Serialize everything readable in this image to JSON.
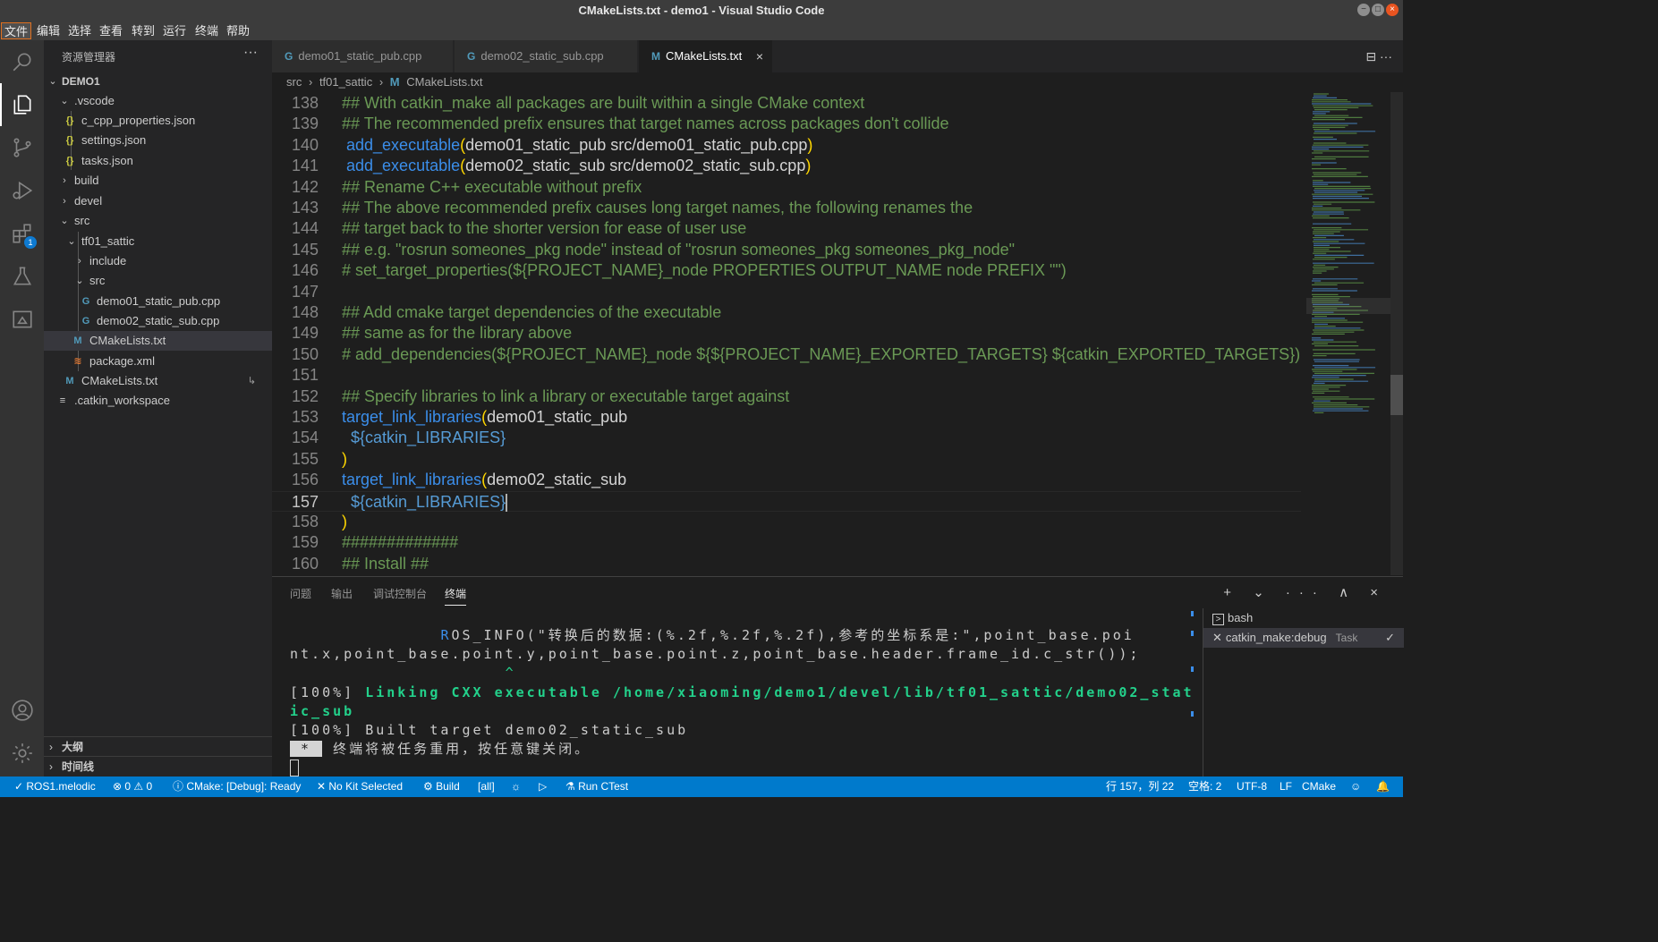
{
  "window": {
    "title": "CMakeLists.txt - demo1 - Visual Studio Code",
    "controls": [
      "−",
      "□",
      "×"
    ]
  },
  "menu": [
    "文件",
    "编辑",
    "选择",
    "查看",
    "转到",
    "运行",
    "终端",
    "帮助"
  ],
  "activity": {
    "items": [
      "search-icon",
      "explorer-icon",
      "source-control-icon",
      "run-debug-icon",
      "extensions-icon",
      "testing-icon",
      "remote-explorer-icon",
      "account-icon",
      "settings-gear-icon"
    ],
    "extensions_badge": "1"
  },
  "sidebar": {
    "title": "资源管理器",
    "more": "···",
    "root": "DEMO1",
    "tree": [
      {
        "label": ".vscode",
        "icon": "",
        "chev": "⌄"
      },
      {
        "label": "c_cpp_properties.json",
        "icon": "{}"
      },
      {
        "label": "settings.json",
        "icon": "{}"
      },
      {
        "label": "tasks.json",
        "icon": "{}"
      },
      {
        "label": "build",
        "chev": "›"
      },
      {
        "label": "devel",
        "chev": "›"
      },
      {
        "label": "src",
        "chev": "⌄"
      },
      {
        "label": "tf01_sattic",
        "chev": "⌄"
      },
      {
        "label": "include",
        "chev": "›"
      },
      {
        "label": "src",
        "chev": "⌄"
      },
      {
        "label": "demo01_static_pub.cpp",
        "icon": "G"
      },
      {
        "label": "demo02_static_sub.cpp",
        "icon": "G"
      },
      {
        "label": "CMakeLists.txt",
        "icon": "M"
      },
      {
        "label": "package.xml",
        "icon": "≋"
      },
      {
        "label": "CMakeLists.txt",
        "icon": "M",
        "extra": "↳"
      },
      {
        "label": ".catkin_workspace",
        "icon": "≡"
      }
    ],
    "outline": "大纲",
    "timeline": "时间线"
  },
  "tabs": [
    {
      "icon": "G",
      "label": "demo01_static_pub.cpp"
    },
    {
      "icon": "G",
      "label": "demo02_static_sub.cpp"
    },
    {
      "icon": "M",
      "label": "CMakeLists.txt",
      "close": "×"
    }
  ],
  "tab_actions": "⊟  ···",
  "breadcrumb": [
    "src",
    "›",
    "tf01_sattic",
    "›",
    "M",
    "CMakeLists.txt"
  ],
  "editor": {
    "lines": [
      {
        "n": "138",
        "t": "## With catkin_make all packages are built within a single CMake context"
      },
      {
        "n": "139",
        "t": "## The recommended prefix ensures that target names across packages don't collide"
      },
      {
        "n": "140",
        "fn": " add_executable",
        "p1": "(",
        "args": "demo01_static_pub src/demo01_static_pub.cpp",
        "p2": ")"
      },
      {
        "n": "141",
        "fn": " add_executable",
        "p1": "(",
        "args": "demo02_static_sub src/demo02_static_sub.cpp",
        "p2": ")"
      },
      {
        "n": "142",
        "t": "## Rename C++ executable without prefix"
      },
      {
        "n": "143",
        "t": "## The above recommended prefix causes long target names, the following renames the"
      },
      {
        "n": "144",
        "t": "## target back to the shorter version for ease of user use"
      },
      {
        "n": "145",
        "t": "## e.g. \"rosrun someones_pkg node\" instead of \"rosrun someones_pkg someones_pkg_node\""
      },
      {
        "n": "146",
        "t": "# set_target_properties(${PROJECT_NAME}_node PROPERTIES OUTPUT_NAME node PREFIX \"\")"
      },
      {
        "n": "147",
        "t": ""
      },
      {
        "n": "148",
        "t": "## Add cmake target dependencies of the executable"
      },
      {
        "n": "149",
        "t": "## same as for the library above"
      },
      {
        "n": "150",
        "t": "# add_dependencies(${PROJECT_NAME}_node ${${PROJECT_NAME}_EXPORTED_TARGETS} ${catkin_EXPORTED_TARGETS})"
      },
      {
        "n": "151",
        "t": ""
      },
      {
        "n": "152",
        "t": "## Specify libraries to link a library or executable target against"
      },
      {
        "n": "153",
        "fn": "target_link_libraries",
        "p1": "(",
        "args": "demo01_static_pub",
        "p2": ""
      },
      {
        "n": "154",
        "var": "  ${catkin_LIBRARIES}"
      },
      {
        "n": "155",
        "pa": ")"
      },
      {
        "n": "156",
        "fn": "target_link_libraries",
        "p1": "(",
        "args": "demo02_static_sub",
        "p2": ""
      },
      {
        "n": "157",
        "var": "  ${catkin_LIBRARIES}",
        "cursor": true
      },
      {
        "n": "158",
        "pa": ")"
      },
      {
        "n": "159",
        "t": "#############"
      },
      {
        "n": "160",
        "t": "## Install ##"
      }
    ]
  },
  "panel": {
    "tabs": [
      "问题",
      "输出",
      "调试控制台",
      "终端"
    ],
    "actions": "+ ⌄ ··· ∧ ×",
    "terminal": {
      "l1_pre": "              ",
      "l1_hl": "R",
      "l1": "OS_INFO(\"转换后的数据:(%.2f,%.2f,%.2f),参考的坐标系是:\",point_base.poi",
      "l2": "nt.x,point_base.point.y,point_base.point.z,point_base.header.frame_id.c_str());",
      "l3": "                    ^",
      "l4_pre": "[100%] ",
      "l4": "Linking CXX executable /home/xiaoming/demo1/devel/lib/tf01_sattic/demo02_stat",
      "l5": "ic_sub",
      "l6": "[100%] Built target demo02_static_sub",
      "l7_inv": " * ",
      "l7": " 终端将被任务重用，按任意键关闭。"
    },
    "terminals": [
      {
        "label": "bash",
        "icon": ">"
      },
      {
        "label": "catkin_make:debug",
        "task": "Task",
        "check": "✓"
      }
    ]
  },
  "status": {
    "remote": "✓ ROS1.melodic",
    "problems": "⊗ 0 ⚠ 0",
    "cmake": "ⓘ CMake: [Debug]: Ready",
    "kit": "✕ No Kit Selected",
    "build": "⚙ Build",
    "target": "[all]",
    "debug": "☼",
    "run": "▷",
    "ctest": "⚗ Run CTest",
    "position": "行 157，列 22",
    "spaces": "空格: 2",
    "encoding": "UTF-8",
    "eol": "LF",
    "language": "CMake",
    "feedback": "☺",
    "notifications": "🔔"
  }
}
